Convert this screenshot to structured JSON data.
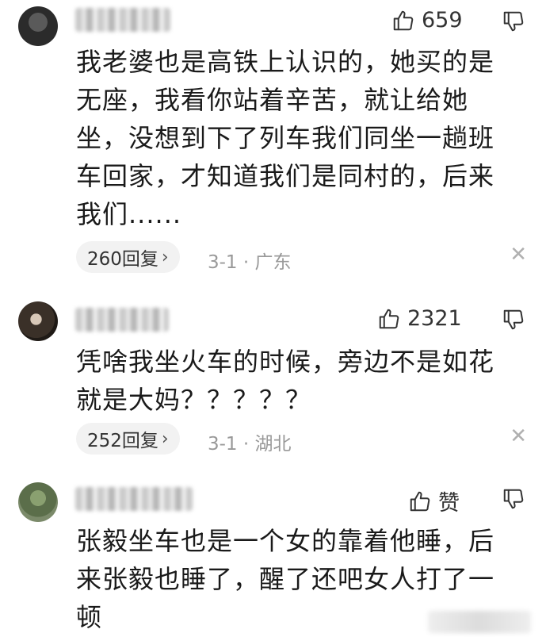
{
  "comments": [
    {
      "like_count": "659",
      "text": "我老婆也是高铁上认识的，她买的是无座，我看你站着辛苦，就让给她坐，没想到下了列车我们同坐一趟班车回家，才知道我们是同村的，后来我们......",
      "reply_label": "260回复",
      "meta": "3-1 · 广东"
    },
    {
      "like_count": "2321",
      "text": "凭啥我坐火车的时候，旁边不是如花就是大妈？？？？？",
      "reply_label": "252回复",
      "meta": "3-1 · 湖北"
    },
    {
      "like_count": "赞",
      "text": "张毅坐车也是一个女的靠着他睡，后来张毅也睡了，醒了还吧女人打了一顿"
    }
  ],
  "icons": {
    "like": "thumbs-up-icon",
    "dislike": "thumbs-down-icon",
    "reply_chevron": "chevron-right-icon",
    "close": "close-icon"
  }
}
